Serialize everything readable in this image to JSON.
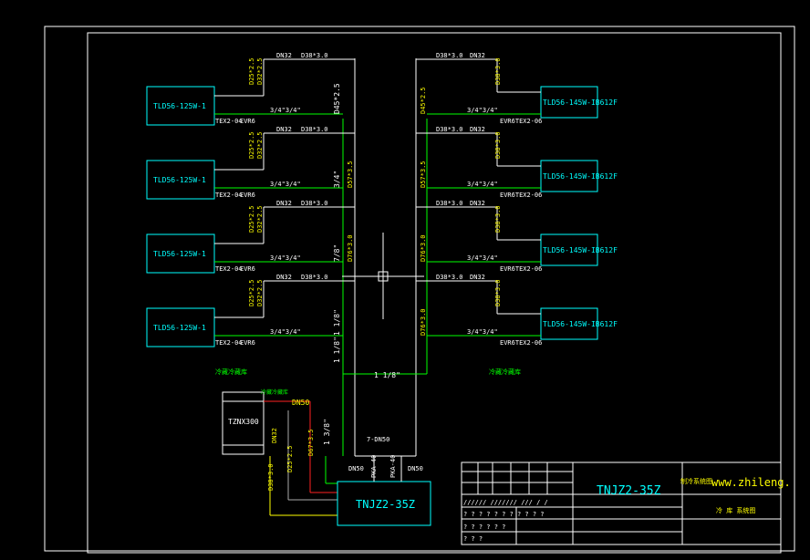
{
  "units": {
    "left_label": "TLD56-125W-1",
    "right_label": "TLD56-145W-IB612F",
    "tank_label": "TZNX300",
    "main_label": "TNJZ2-35Z"
  },
  "pipe_texts": {
    "dn32": "DN32",
    "dn50": "DN50",
    "d38": "D38*3.0",
    "d25": "D25*2.5",
    "d32": "D32*2.5",
    "d45": "D45*2.5",
    "d57": "D57*3.5",
    "d76": "D76*3.0",
    "d67": "D67*3.5",
    "d38v": "D38*3.0",
    "d25v": "D25*2.5",
    "size_34": "3/4\"",
    "size_7_8": "7/8\"",
    "size_1_1_8": "1 1/8\"",
    "size_1_3_8": "1 3/8\"",
    "size_34_34": "3/4\"3/4\"",
    "size_3_4_3_4": "3/4\"3/4\"",
    "tex": "TEX2-04",
    "evr": "EVR6",
    "evr_tex": "EVR6TEX2-06",
    "pka": "PKA-40",
    "dn50_7": "7-DN50"
  },
  "notes": {
    "left_zone": "冷藏冷藏库",
    "right_zone": "冷藏冷藏库",
    "small_tag": "冷藏冷藏库"
  },
  "title_block": {
    "model": "TNJZ2-35Z",
    "site": "www.zhileng.",
    "dept": "制冷系统图",
    "caption": "冷 库 系统图",
    "row_marks": "//////  ///////  ///  /  /",
    "row_q1": "?   ? ?    ? ? ? ? ? ? ? ?",
    "row_q2": "?   ? ?    ?      ? ?",
    "row_q3": "?   ? ?"
  },
  "colors": {
    "pipe_white": "#ffffff",
    "pipe_green": "#00ff00",
    "text_yellow": "#ffff00",
    "unit_cyan": "#00ffff",
    "pipe_red": "#ff2020",
    "pipe_gray": "#a0a0a0",
    "text_green": "#00ff00",
    "magenta": "#ff00ff"
  }
}
